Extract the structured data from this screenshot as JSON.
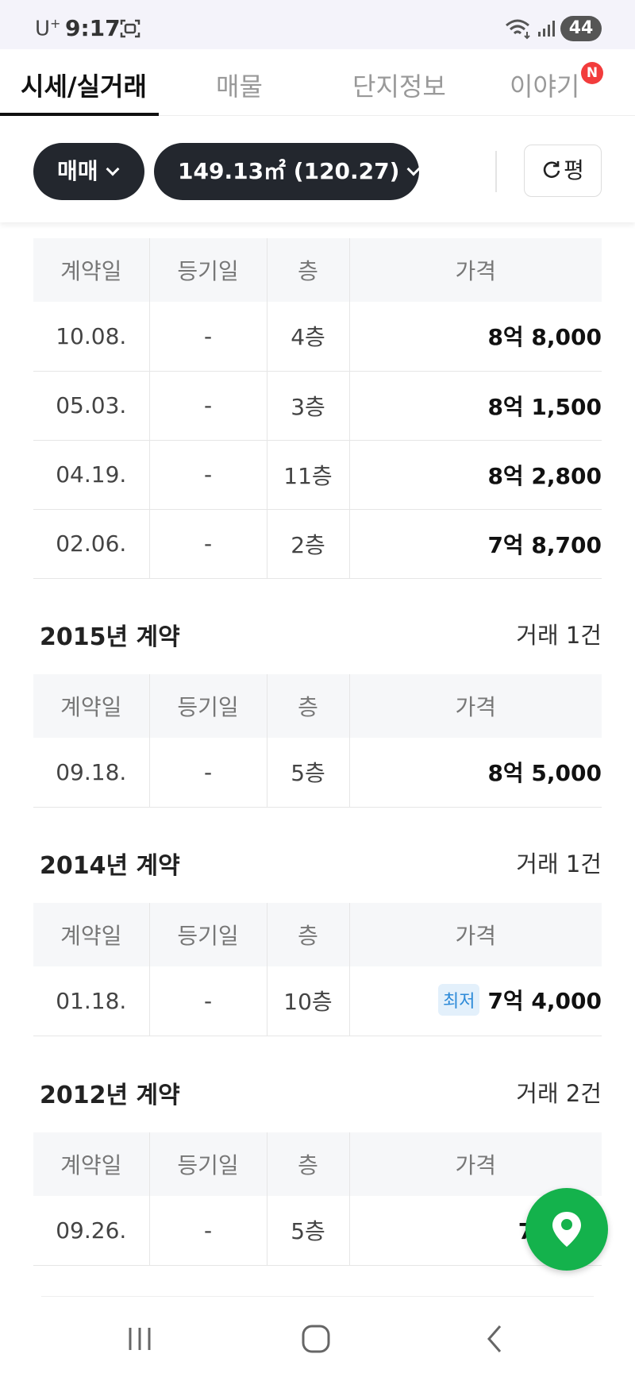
{
  "status_bar": {
    "carrier": "U",
    "carrier_sup": "+",
    "time": "9:17",
    "battery": "44",
    "icons": [
      "screen-record-icon",
      "wifi-icon",
      "signal-icon",
      "battery-icon"
    ]
  },
  "tabs": [
    {
      "label": "시세/실거래",
      "active": true
    },
    {
      "label": "매물",
      "active": false
    },
    {
      "label": "단지정보",
      "active": false
    },
    {
      "label": "이야기",
      "active": false,
      "badge": "N"
    }
  ],
  "filters": {
    "trade_type": "매매",
    "area": "149.13㎡ (120.27)",
    "unit_toggle": "평"
  },
  "columns": [
    "계약일",
    "등기일",
    "층",
    "가격"
  ],
  "sections": [
    {
      "year_title": "",
      "count": "",
      "rows": [
        {
          "date": "10.08.",
          "reg": "-",
          "floor": "4층",
          "price": "8억 8,000"
        },
        {
          "date": "05.03.",
          "reg": "-",
          "floor": "3층",
          "price": "8억 1,500"
        },
        {
          "date": "04.19.",
          "reg": "-",
          "floor": "11층",
          "price": "8억 2,800"
        },
        {
          "date": "02.06.",
          "reg": "-",
          "floor": "2층",
          "price": "7억 8,700"
        }
      ]
    },
    {
      "year_title": "2015년 계약",
      "count": "거래 1건",
      "rows": [
        {
          "date": "09.18.",
          "reg": "-",
          "floor": "5층",
          "price": "8억 5,000"
        }
      ]
    },
    {
      "year_title": "2014년 계약",
      "count": "거래 1건",
      "rows": [
        {
          "date": "01.18.",
          "reg": "-",
          "floor": "10층",
          "price": "7억 4,000",
          "badge": "최저"
        }
      ]
    },
    {
      "year_title": "2012년 계약",
      "count": "거래 2건",
      "rows": [
        {
          "date": "09.26.",
          "reg": "-",
          "floor": "5층",
          "price": "7억"
        }
      ]
    }
  ],
  "colors": {
    "chip_bg": "#23272e",
    "fab": "#14b24c",
    "lowest_badge_bg": "#e3f0fb",
    "lowest_badge_text": "#2d8ad8",
    "new_badge": "#f23c3c"
  }
}
